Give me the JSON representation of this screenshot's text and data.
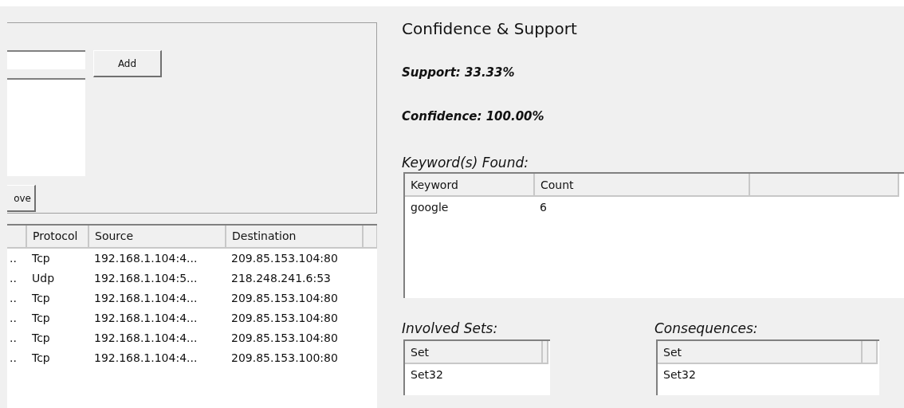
{
  "filter_panel": {
    "add_button": "Add",
    "remove_button": "ove"
  },
  "packets": {
    "columns": [
      "Protocol",
      "Source",
      "Destination"
    ],
    "rows": [
      {
        "column_1": "..",
        "protocol": "Tcp",
        "source": "192.168.1.104:4...",
        "destination": "209.85.153.104:80"
      },
      {
        "column_1": "..",
        "protocol": "Udp",
        "source": "192.168.1.104:5...",
        "destination": "218.248.241.6:53"
      },
      {
        "column_1": "..",
        "protocol": "Tcp",
        "source": "192.168.1.104:4...",
        "destination": "209.85.153.104:80"
      },
      {
        "column_1": "..",
        "protocol": "Tcp",
        "source": "192.168.1.104:4...",
        "destination": "209.85.153.104:80"
      },
      {
        "column_1": "..",
        "protocol": "Tcp",
        "source": "192.168.1.104:4...",
        "destination": "209.85.153.104:80"
      },
      {
        "column_1": "..",
        "protocol": "Tcp",
        "source": "192.168.1.104:4...",
        "destination": "209.85.153.100:80"
      }
    ]
  },
  "rule": {
    "title": "Confidence & Support",
    "support": "Support: 33.33%",
    "confidence": "Confidence: 100.00%"
  },
  "keywords": {
    "label": "Keyword(s) Found:",
    "columns": [
      "Keyword",
      "Count"
    ],
    "rows": [
      [
        "google",
        "6"
      ]
    ]
  },
  "involved_sets": {
    "label": "Involved Sets:",
    "columns": [
      "Set"
    ],
    "rows": [
      [
        "Set32"
      ]
    ]
  },
  "consequences": {
    "label": "Consequences:",
    "columns": [
      "Set"
    ],
    "rows": [
      [
        "Set32"
      ]
    ]
  }
}
